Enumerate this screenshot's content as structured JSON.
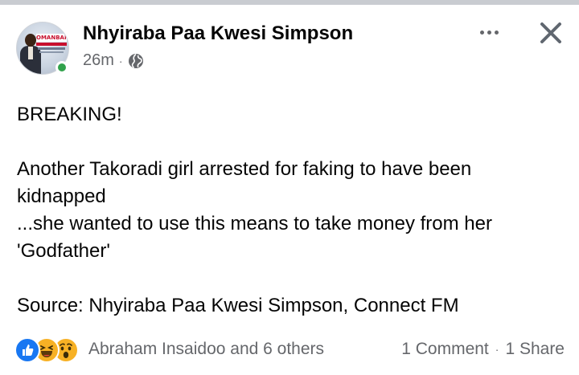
{
  "post": {
    "author": "Nhyiraba Paa Kwesi Simpson",
    "time": "26m",
    "meta_separator": "·",
    "avatar_brand": "OMANBAPA",
    "lines": [
      "BREAKING!",
      "",
      "Another Takoradi girl arrested for faking to have been",
      "kidnapped",
      "...she wanted to use this means to take money from her",
      "'Godfather'",
      "",
      "Source: Nhyiraba Paa Kwesi Simpson, Connect FM"
    ],
    "reactions_text": "Abraham Insaidoo and 6 others",
    "comments": "1 Comment",
    "counts_separator": "·",
    "shares": "1 Share"
  },
  "icons": {
    "privacy": "globe-icon",
    "reactions": [
      "like-reaction-icon",
      "haha-reaction-icon",
      "wow-reaction-icon"
    ],
    "more": "more-options-icon",
    "close": "close-icon"
  },
  "colors": {
    "text": "#050505",
    "secondary": "#65676b",
    "online": "#31a24c",
    "like": "#1877f2",
    "emoji": "#f7b125"
  }
}
